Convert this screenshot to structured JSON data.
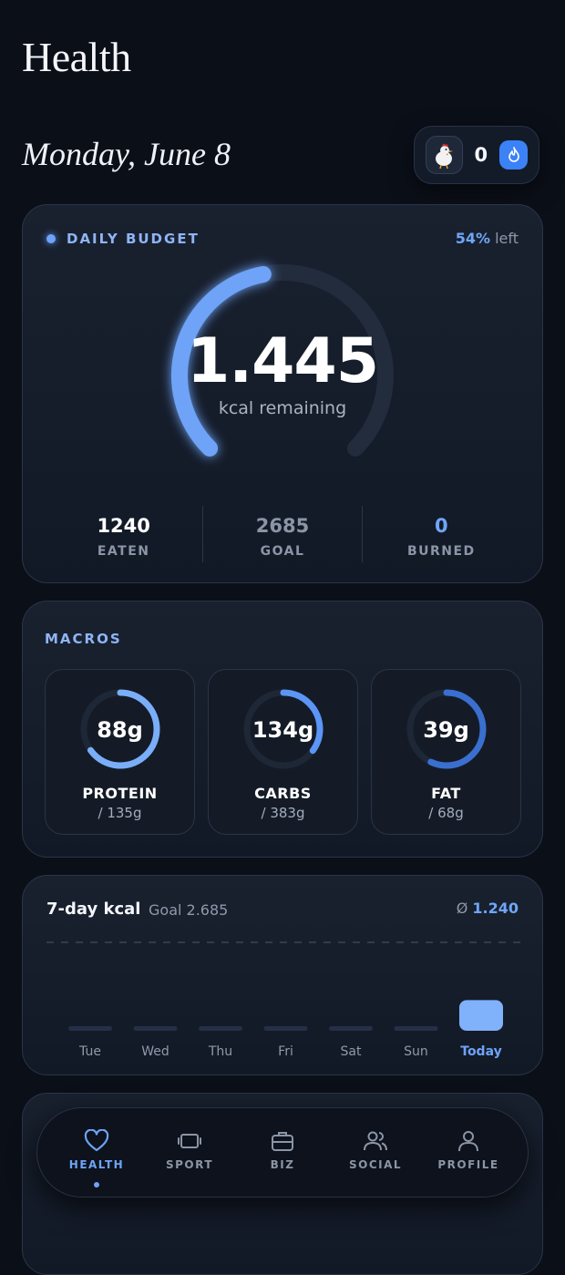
{
  "header": {
    "title": "Health",
    "date": "Monday, June 8"
  },
  "streak": {
    "count": "0",
    "avatar_icon": "chicken-avatar-icon",
    "badge_icon": "flame-icon"
  },
  "budget": {
    "label": "DAILY BUDGET",
    "percent": "54%",
    "percent_suffix": " left",
    "remaining": "1.445",
    "remaining_label": "kcal remaining",
    "progress_fraction": 0.54,
    "stats": [
      {
        "value": "1240",
        "label": "EATEN",
        "color": "#ffffff"
      },
      {
        "value": "2685",
        "label": "GOAL",
        "color": "#8b95a6"
      },
      {
        "value": "0",
        "label": "BURNED",
        "color": "#6fa6f8"
      }
    ]
  },
  "macros": {
    "title": "MACROS",
    "items": [
      {
        "value": "88g",
        "name": "PROTEIN",
        "goal": "/ 135g",
        "fraction": 0.65,
        "color": "#7aaef9"
      },
      {
        "value": "134g",
        "name": "CARBS",
        "goal": "/ 383g",
        "fraction": 0.35,
        "color": "#5b95f5"
      },
      {
        "value": "39g",
        "name": "FAT",
        "goal": "/ 68g",
        "fraction": 0.57,
        "color": "#3a6fd0"
      }
    ]
  },
  "week": {
    "title": "7-day kcal",
    "goal_label": "Goal 2.685",
    "avg_symbol": "Ø",
    "avg_value": "1.240",
    "goal_value": 2685,
    "days": [
      "Tue",
      "Wed",
      "Thu",
      "Fri",
      "Sat",
      "Sun",
      "Today"
    ],
    "values": [
      0,
      0,
      0,
      0,
      0,
      0,
      1240
    ],
    "today_color": "#80b1fb"
  },
  "tabs": [
    {
      "label": "HEALTH",
      "icon": "heart-icon",
      "active": true
    },
    {
      "label": "SPORT",
      "icon": "dumbbell-icon",
      "active": false
    },
    {
      "label": "BIZ",
      "icon": "briefcase-icon",
      "active": false
    },
    {
      "label": "SOCIAL",
      "icon": "people-icon",
      "active": false
    },
    {
      "label": "PROFILE",
      "icon": "person-icon",
      "active": false
    }
  ],
  "colors": {
    "accent": "#6ea3f7",
    "background": "#0b0f18",
    "card": "#151c29"
  }
}
